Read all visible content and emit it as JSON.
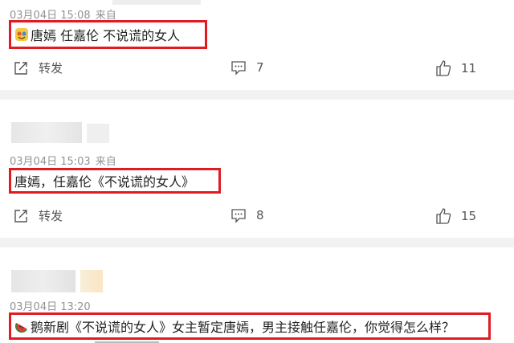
{
  "posts": [
    {
      "timestamp": "03月04日 15:08",
      "source_prefix": "来自",
      "content": "唐嫣 任嘉伦 不说谎的女人",
      "repost_label": "转发",
      "comment_count": "7",
      "like_count": "11"
    },
    {
      "timestamp": "03月04日 15:03",
      "source_prefix": "来自",
      "content": "唐嫣，任嘉伦《不说谎的女人》",
      "repost_label": "转发",
      "comment_count": "8",
      "like_count": "15"
    },
    {
      "timestamp": "03月04日 13:20",
      "content": "鹅新剧《不说谎的女人》女主暂定唐嫣，男主接触任嘉伦，你觉得怎么样？"
    }
  ],
  "colors": {
    "highlight_box": "#e01b22",
    "meta_text": "#939393",
    "divider": "#f2f2f2"
  },
  "icons": [
    "emoji-badge-icon",
    "repost-icon",
    "comment-icon",
    "like-icon",
    "watermelon-icon"
  ]
}
